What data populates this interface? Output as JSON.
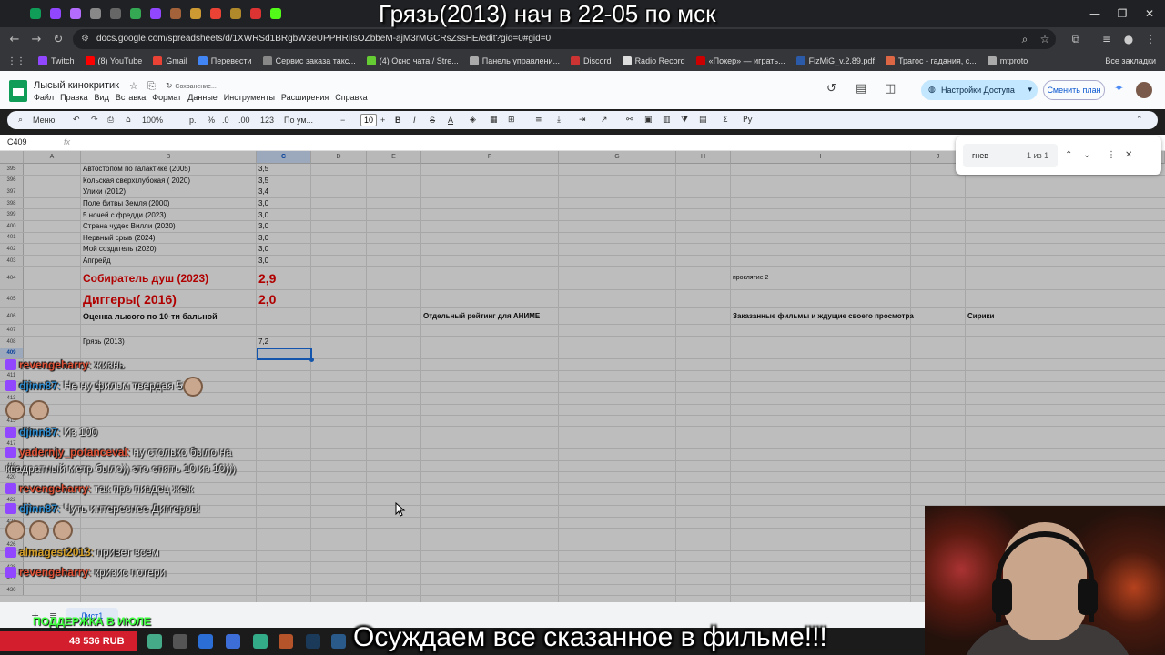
{
  "overlay": {
    "stream_title": "Грязь(2013) нач в 22-05 по мск",
    "bottom_caption": "Осуждаем все сказанное в фильме!!!",
    "support_text": "ПОДДЕРЖКА В ИЮЛЕ",
    "rub_amount": "48 536 RUB"
  },
  "browser": {
    "url": "docs.google.com/spreadsheets/d/1XWRSd1BRgbW3eUPPHRiIsOZbbeM-ajM3rMGCRsZssHE/edit?gid=0#gid=0",
    "bookmarks": [
      {
        "label": "Twitch",
        "color": "#9146ff"
      },
      {
        "label": "(8) YouTube",
        "color": "#ff0000"
      },
      {
        "label": "Gmail",
        "color": "#ea4335"
      },
      {
        "label": "Перевести",
        "color": "#4285f4"
      },
      {
        "label": "Сервис заказа такс...",
        "color": "#888888"
      },
      {
        "label": "(4) Окно чата / Stre...",
        "color": "#6c3"
      },
      {
        "label": "Панель управлени...",
        "color": "#aaaaaa"
      },
      {
        "label": "Discord",
        "color": "#c33"
      },
      {
        "label": "Radio Record",
        "color": "#ddd"
      },
      {
        "label": "«Покер» — играть...",
        "color": "#c00"
      },
      {
        "label": "FizMiG_v.2.89.pdf",
        "color": "#2b5aa8"
      },
      {
        "label": "Трагос - гадания, с...",
        "color": "#d64"
      },
      {
        "label": "mtproto",
        "color": "#aaa"
      }
    ],
    "all_bookmarks": "Все закладки"
  },
  "sheets": {
    "title": "Лысый кинокритик",
    "saving": "Сохранение...",
    "menu": [
      "Файл",
      "Правка",
      "Вид",
      "Вставка",
      "Формат",
      "Данные",
      "Инструменты",
      "Расширения",
      "Справка"
    ],
    "share_label": "Настройки Доступа",
    "plan_label": "Сменить план",
    "toolbar": {
      "menu_label": "Меню",
      "zoom": "100%",
      "currency": "р.",
      "percent": "%",
      "dec_less": ".0",
      "dec_more": ".00",
      "num_format": "123",
      "font": "По ум...",
      "font_size": "10"
    },
    "cell_ref": "C409",
    "fx": "fx",
    "find": {
      "query": "гнев",
      "count": "1 из 1"
    },
    "sheet_tab": "Лист1",
    "columns": [
      "A",
      "B",
      "C",
      "D",
      "E",
      "F",
      "G",
      "H",
      "I",
      "J"
    ],
    "rows": [
      {
        "num": "395",
        "b": "Автостопом по галактике (2005)",
        "c": "3,5"
      },
      {
        "num": "396",
        "b": "Кольская сверхглубокая ( 2020)",
        "c": "3,5"
      },
      {
        "num": "397",
        "b": "Улики (2012)",
        "c": "3,4"
      },
      {
        "num": "398",
        "b": "Поле битвы Земля (2000)",
        "c": "3,0"
      },
      {
        "num": "399",
        "b": "5 ночей с фредди (2023)",
        "c": "3,0"
      },
      {
        "num": "400",
        "b": "Страна чудес Вилли (2020)",
        "c": "3,0"
      },
      {
        "num": "401",
        "b": "Нервный срыв (2024)",
        "c": "3,0"
      },
      {
        "num": "402",
        "b": "Мой создатель (2020)",
        "c": "3,0"
      },
      {
        "num": "403",
        "b": "Апгрейд",
        "c": "3,0"
      },
      {
        "num": "404",
        "b": "Собиратель душ (2023)",
        "c": "2,9",
        "i": "проклятие 2"
      },
      {
        "num": "405",
        "b": "Диггеры( 2016)",
        "c": "2,0"
      },
      {
        "num": "406",
        "b": "Оценка лысого по 10-ти бальной",
        "f": "Отдельный рейтинг для АНИМЕ",
        "i": "Заказанные фильмы и ждущие своего просмотра",
        "k": "Сирики"
      },
      {
        "num": "407",
        "b": "",
        "c": ""
      },
      {
        "num": "408",
        "b": "Грязь (2013)",
        "c": "7,2"
      },
      {
        "num": "409",
        "b": "",
        "c": ""
      }
    ],
    "extra_row_nums": [
      "410",
      "411",
      "412",
      "413",
      "414",
      "415",
      "416",
      "417",
      "418",
      "419",
      "420",
      "421",
      "422",
      "423",
      "424",
      "425",
      "426",
      "427",
      "428",
      "429",
      "430"
    ]
  },
  "chat": [
    {
      "user": "revengeharry",
      "color": "#e0553a",
      "text": "жизнь"
    },
    {
      "user": "djinn87",
      "color": "#2e8ccf",
      "text": "Не ну фильм твердая 5"
    },
    {
      "user": "",
      "color": "#ffffff",
      "text": "",
      "emotes": 2
    },
    {
      "user": "djinn87",
      "color": "#2e8ccf",
      "text": "Из 100"
    },
    {
      "user": "yadernjy_potanceval",
      "color": "#e0553a",
      "text": "ну столько было на квадратный метр было)) это опять 10 из 10)))"
    },
    {
      "user": "revengeharry",
      "color": "#e0553a",
      "text": "так про пиздец жеж"
    },
    {
      "user": "djinn87",
      "color": "#2e8ccf",
      "text": "Чуть интереснее Диггеров!"
    },
    {
      "user": "",
      "color": "#ffffff",
      "text": "",
      "emotes": 3
    },
    {
      "user": "almagest2013",
      "color": "#d6a12b",
      "text": "привет всем"
    },
    {
      "user": "revengeharry",
      "color": "#e0553a",
      "text": "кризис потери"
    }
  ]
}
